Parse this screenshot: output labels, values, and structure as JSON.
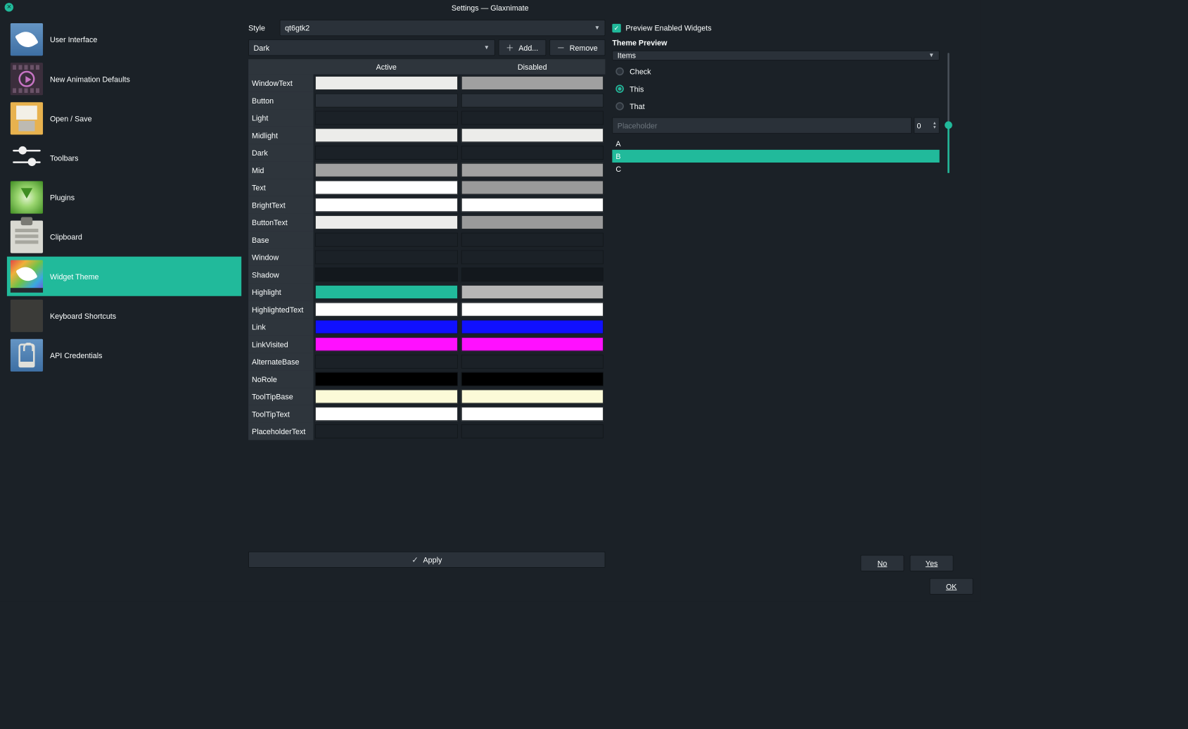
{
  "window_title": "Settings — Glaxnimate",
  "sidebar": {
    "items": [
      {
        "label": "User Interface"
      },
      {
        "label": "New Animation Defaults"
      },
      {
        "label": "Open / Save"
      },
      {
        "label": "Toolbars"
      },
      {
        "label": "Plugins"
      },
      {
        "label": "Clipboard"
      },
      {
        "label": "Widget Theme"
      },
      {
        "label": "Keyboard Shortcuts"
      },
      {
        "label": "API Credentials"
      }
    ],
    "selected_index": 6
  },
  "main": {
    "style_label": "Style",
    "style_value": "qt6gtk2",
    "theme_value": "Dark",
    "add_btn": "Add...",
    "remove_btn": "Remove",
    "table": {
      "header_active": "Active",
      "header_disabled": "Disabled",
      "rows": [
        {
          "role": "WindowText",
          "active": "#ececea",
          "disabled": "#a0a0a0"
        },
        {
          "role": "Button",
          "active": "#2b323a",
          "disabled": "#2b323a"
        },
        {
          "role": "Light",
          "active": "#1b2127",
          "disabled": "#1b2127"
        },
        {
          "role": "Midlight",
          "active": "#ececea",
          "disabled": "#ececea"
        },
        {
          "role": "Dark",
          "active": "#1b2127",
          "disabled": "#1b2127"
        },
        {
          "role": "Mid",
          "active": "#a1a1a1",
          "disabled": "#a1a1a1"
        },
        {
          "role": "Text",
          "active": "#ffffff",
          "disabled": "#9a9a9a"
        },
        {
          "role": "BrightText",
          "active": "#ffffff",
          "disabled": "#ffffff"
        },
        {
          "role": "ButtonText",
          "active": "#ececea",
          "disabled": "#9a9a9a"
        },
        {
          "role": "Base",
          "active": "#1b2127",
          "disabled": "#1b2127"
        },
        {
          "role": "Window",
          "active": "#1b2127",
          "disabled": "#1b2127"
        },
        {
          "role": "Shadow",
          "active": "#13181d",
          "disabled": "#13181d"
        },
        {
          "role": "Highlight",
          "active": "#21ba9b",
          "disabled": "#b6b6b6"
        },
        {
          "role": "HighlightedText",
          "active": "#ffffff",
          "disabled": "#ffffff"
        },
        {
          "role": "Link",
          "active": "#1010ff",
          "disabled": "#1010ff"
        },
        {
          "role": "LinkVisited",
          "active": "#ff10ff",
          "disabled": "#ff10ff"
        },
        {
          "role": "AlternateBase",
          "active": "#1b2127",
          "disabled": "#1b2127"
        },
        {
          "role": "NoRole",
          "active": "#000000",
          "disabled": "#000000"
        },
        {
          "role": "ToolTipBase",
          "active": "#fcfad8",
          "disabled": "#fcfad8"
        },
        {
          "role": "ToolTipText",
          "active": "#ffffff",
          "disabled": "#ffffff"
        },
        {
          "role": "PlaceholderText",
          "active": "#1b2127",
          "disabled": "#1b2127"
        }
      ]
    },
    "apply_btn": "Apply"
  },
  "preview": {
    "preview_checkbox": "Preview Enabled Widgets",
    "title": "Theme Preview",
    "combo_value": "Items",
    "radios": [
      "Check",
      "This",
      "That"
    ],
    "radio_selected": 1,
    "placeholder_text": "Placeholder",
    "spinner_value": "0",
    "list": [
      "A",
      "B",
      "C"
    ],
    "list_selected": 1,
    "no_btn": "No",
    "yes_btn": "Yes"
  },
  "footer": {
    "ok": "OK"
  }
}
